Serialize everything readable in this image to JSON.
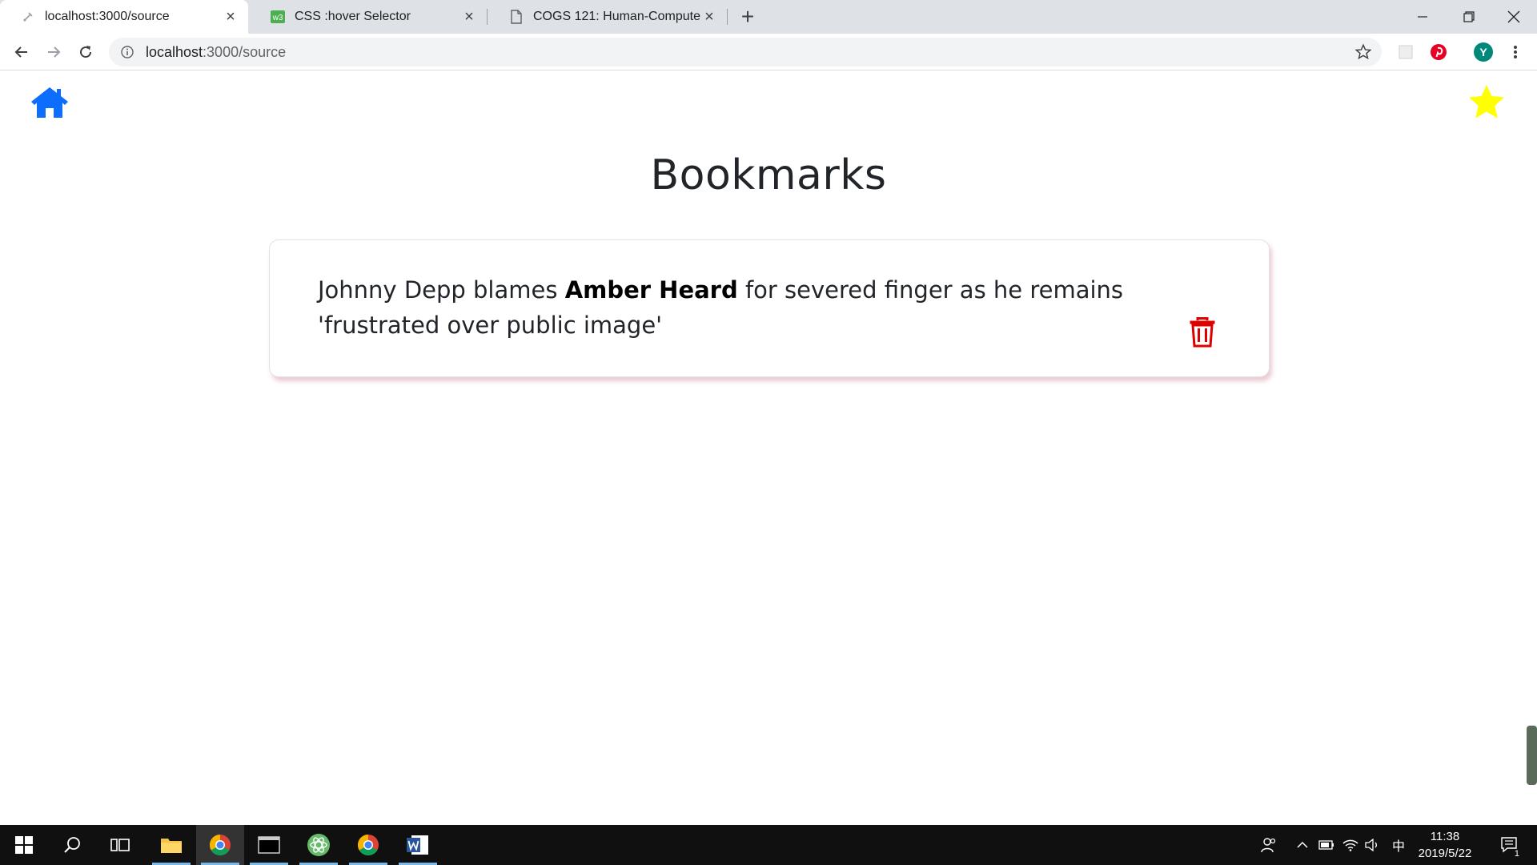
{
  "browser": {
    "tabs": [
      {
        "title": "localhost:3000/source",
        "favicon": "page-loading-icon",
        "active": true
      },
      {
        "title": "CSS :hover Selector",
        "favicon": "w3schools-icon",
        "active": false
      },
      {
        "title": "COGS 121: Human-Computer",
        "favicon": "document-icon",
        "active": false
      }
    ],
    "new_tab_label": "+",
    "address": {
      "host": "localhost",
      "path": ":3000/source"
    },
    "profile_initial": "Y"
  },
  "page": {
    "title": "Bookmarks",
    "bookmarks": [
      {
        "text_before": "Johnny Depp blames ",
        "highlight": "Amber Heard",
        "text_after": " for severed finger as he remains 'frustrated over public image'"
      }
    ]
  },
  "colors": {
    "home_icon": "#0d6efd",
    "star_icon": "#ffff00",
    "trash_icon": "#e00000"
  },
  "taskbar": {
    "time": "11:38",
    "date": "2019/5/22",
    "ime": "中",
    "notification_count": "1"
  }
}
